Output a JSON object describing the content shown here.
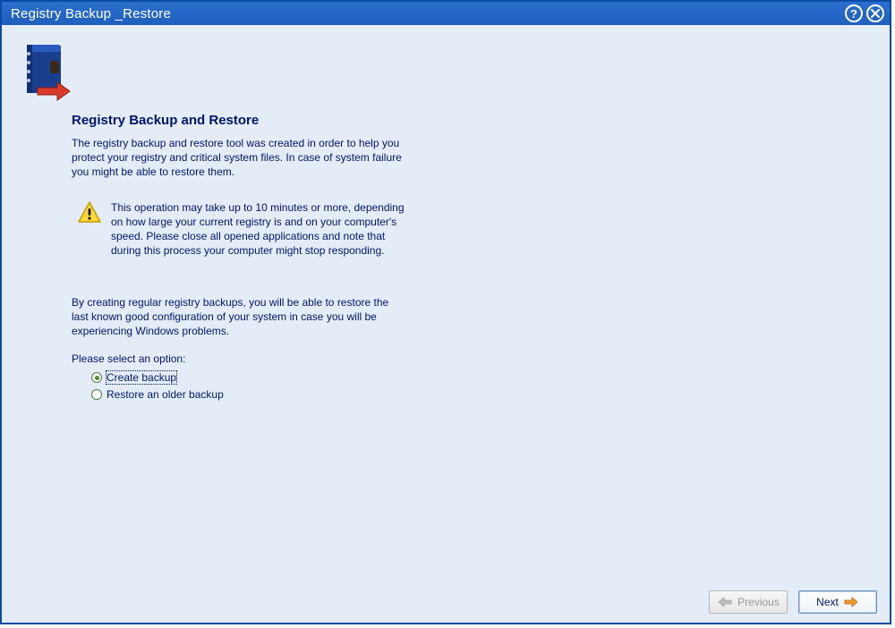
{
  "window": {
    "title": "Registry Backup _Restore"
  },
  "page": {
    "heading": "Registry Backup and Restore",
    "intro": "The registry backup and restore tool was created in order to help you protect your registry and critical system files. In case of system failure you might be able to restore them.",
    "warning": "This operation may take up to 10 minutes or more, depending on how large your current registry is and on your computer's speed. Please close all opened applications and note that during this process your computer might stop responding.",
    "paragraph2": "By creating regular registry backups, you will be able to restore the last known good configuration of your system in case you will be experiencing Windows problems.",
    "select_label": "Please select an option:",
    "options": {
      "create": "Create backup",
      "restore": "Restore an older backup"
    }
  },
  "buttons": {
    "previous": "Previous",
    "next": "Next"
  }
}
